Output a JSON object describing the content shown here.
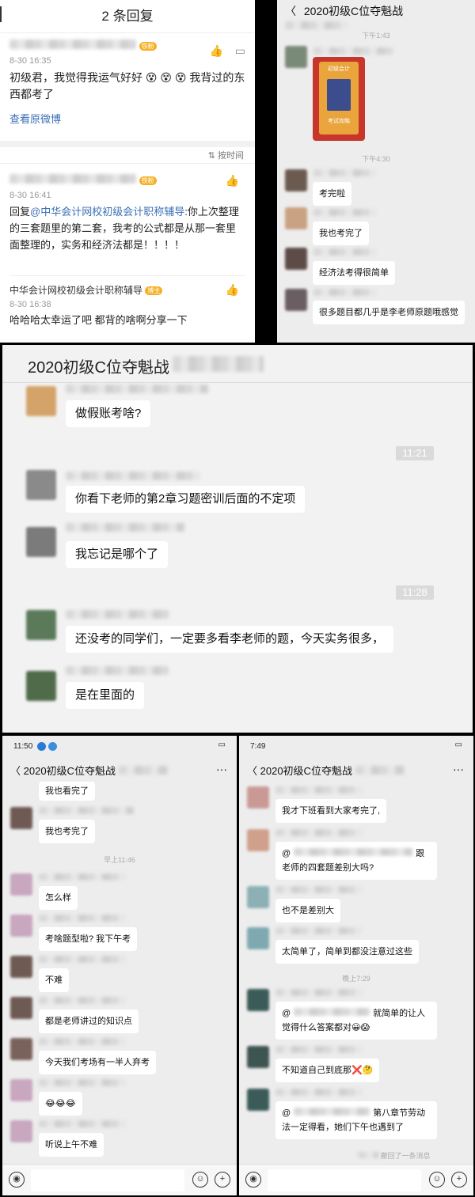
{
  "weibo": {
    "title": "2 条回复",
    "reply1": {
      "time": "8-30 16:35",
      "text": "初级君，我觉得我运气好好 😵 😵 😵 我背过的东西都考了",
      "link": "查看原微博"
    },
    "sort_label": "按时间",
    "reply2": {
      "time": "8-30 16:41",
      "prefix": "回复",
      "mention": "@中华会计网校初级会计职称辅导",
      "text": ":你上次整理的三套题里的第二套，我考的公式都是从那一套里面整理的，实务和经济法都是！！！！"
    },
    "reply3": {
      "author": "中华会计网校初级会计职称辅导",
      "author_badge": "博主",
      "time": "8-30 16:38",
      "text": "哈哈哈太幸运了吧 都背的啥啊分享一下"
    },
    "fan_badge": "铁粉"
  },
  "chat1": {
    "title": "2020初级C位夺魁战",
    "t1": "下午1:43",
    "t2": "下午4:30",
    "poster_label": "初级会计",
    "poster_bottom": "考试攻略",
    "messages": [
      "考完啦",
      "我也考完了",
      "经济法考得很简单",
      "很多题目都几乎是李老师原题哦感觉"
    ]
  },
  "chat2": {
    "title": "2020初级C位夺魁战",
    "messages": [
      "做假账考啥?",
      "你看下老师的第2章习题密训后面的不定项",
      "我忘记是哪个了",
      "还没考的同学们，一定要多看李老师的题，今天实务很多，",
      "是在里面的"
    ],
    "t1": "11:21",
    "t2": "11:28"
  },
  "chat3": {
    "status_time": "11:50",
    "title": "2020初级C位夺魁战",
    "t1": "早上11:46",
    "messages": [
      "我也看完了",
      "我也考完了",
      "怎么样",
      "考啥题型啦? 我下午考",
      "不难",
      "都是老师讲过的知识点",
      "今天我们考场有一半人弃考",
      "😂😂😂",
      "听说上午不难"
    ]
  },
  "chat4": {
    "status_time": "7:49",
    "title": "2020初级C位夺魁战",
    "t1": "晚上7:29",
    "messages": [
      "我才下班看到大家考完了,",
      "@",
      "跟",
      "老师的四套题差别大吗?",
      "也不是差别大",
      "太简单了，简单到都没注意过这些",
      "@",
      "就简单的让人觉得什么答案都对😀😱",
      "不知道自己到底那❌🤔",
      "@",
      "第八章节劳动法一定得看，她们下午也遇到了"
    ],
    "recall": "撤回了一条消息"
  }
}
